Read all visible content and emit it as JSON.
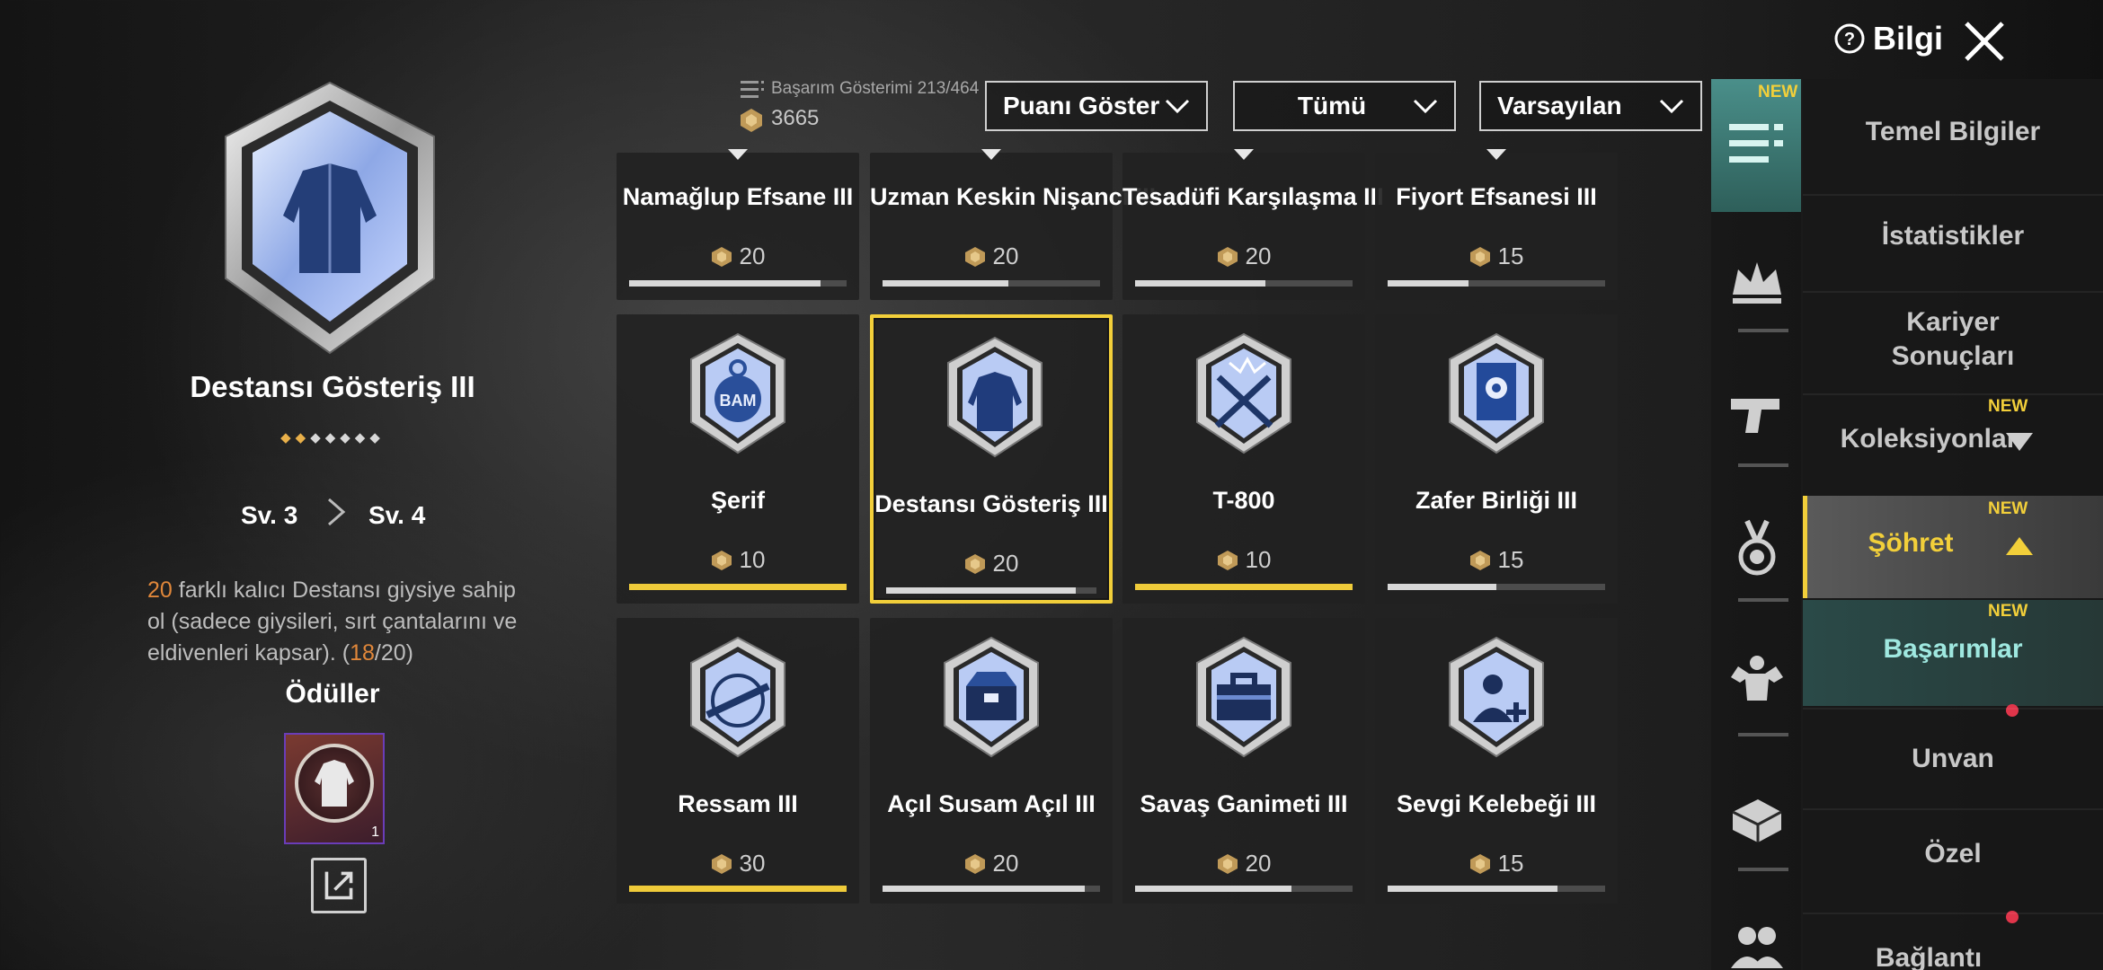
{
  "header": {
    "achievement_count": "Başarım Gösterimi  213/464",
    "points_total": "3665",
    "filters": {
      "points": "Puanı Göster",
      "category": "Tümü",
      "sort": "Varsayılan"
    },
    "help_label": "Bilgi",
    "close_icon": "close-icon"
  },
  "detail": {
    "title": "Destansı Gösteriş III",
    "stars": "◆◆◆◆◆◆◆",
    "level_from": "Sv. 3",
    "level_to": "Sv. 4",
    "desc_count": "20",
    "desc_text": " farklı kalıcı Destansı giysiye sahip ol (sadece giysileri, sırt çantalarını ve eldivenleri kapsar). (",
    "progress_current": "18",
    "progress_total": "/20)",
    "rewards_title": "Ödüller",
    "reward_qty": "1"
  },
  "achievements": [
    {
      "name": "Namağlup Efsane III",
      "points": "20",
      "progress": 0.88,
      "complete": false,
      "icon": "shield-icon"
    },
    {
      "name": "Uzman Keskin Nişancı III",
      "points": "20",
      "progress": 0.58,
      "complete": false,
      "icon": "shield-icon"
    },
    {
      "name": "Tesadüfi Karşılaşma III",
      "points": "20",
      "progress": 0.6,
      "complete": false,
      "icon": "shield-icon"
    },
    {
      "name": "Fiyort Efsanesi III",
      "points": "15",
      "progress": 0.37,
      "complete": false,
      "icon": "shield-icon"
    },
    {
      "name": "Şerif",
      "points": "10",
      "progress": 1.0,
      "complete": true,
      "icon": "sheriff-bag-icon",
      "emblem": "BAM"
    },
    {
      "name": "Destansı Gösteriş III",
      "points": "20",
      "progress": 0.9,
      "complete": false,
      "icon": "jacket-icon",
      "selected": true
    },
    {
      "name": "T-800",
      "points": "10",
      "progress": 1.0,
      "complete": true,
      "icon": "crossed-rifles-icon"
    },
    {
      "name": "Zafer Birliği III",
      "points": "15",
      "progress": 0.5,
      "complete": false,
      "icon": "banner-icon"
    },
    {
      "name": "Ressam III",
      "points": "30",
      "progress": 1.0,
      "complete": true,
      "icon": "rifle-target-icon"
    },
    {
      "name": "Açıl Susam Açıl III",
      "points": "20",
      "progress": 0.93,
      "complete": false,
      "icon": "chest-icon"
    },
    {
      "name": "Savaş Ganimeti III",
      "points": "20",
      "progress": 0.72,
      "complete": false,
      "icon": "toolbox-icon"
    },
    {
      "name": "Sevgi Kelebeği III",
      "points": "15",
      "progress": 0.78,
      "complete": false,
      "icon": "add-friend-icon"
    }
  ],
  "side_tabs": [
    {
      "icon": "list-icon",
      "new": "NEW",
      "active": true
    },
    {
      "icon": "crown-icon"
    },
    {
      "icon": "pistol-icon"
    },
    {
      "icon": "medal-icon"
    },
    {
      "icon": "muscle-icon"
    },
    {
      "icon": "crate-icon"
    },
    {
      "icon": "friends-icon"
    }
  ],
  "menu": {
    "basic_info": "Temel Bilgiler",
    "statistics": "İstatistikler",
    "career_1": "Kariyer",
    "career_2": "Sonuçları",
    "collections": "Koleksiyonlar",
    "fame": "Şöhret",
    "achievements": "Başarımlar",
    "title": "Unvan",
    "special": "Özel",
    "connection": "Bağlantı",
    "new_tag": "NEW"
  },
  "colors": {
    "accent_gold": "#f2cf3a",
    "accent_teal": "#9fe8e0",
    "highlight_orange": "#e0873a",
    "notification_red": "#e0354a"
  }
}
